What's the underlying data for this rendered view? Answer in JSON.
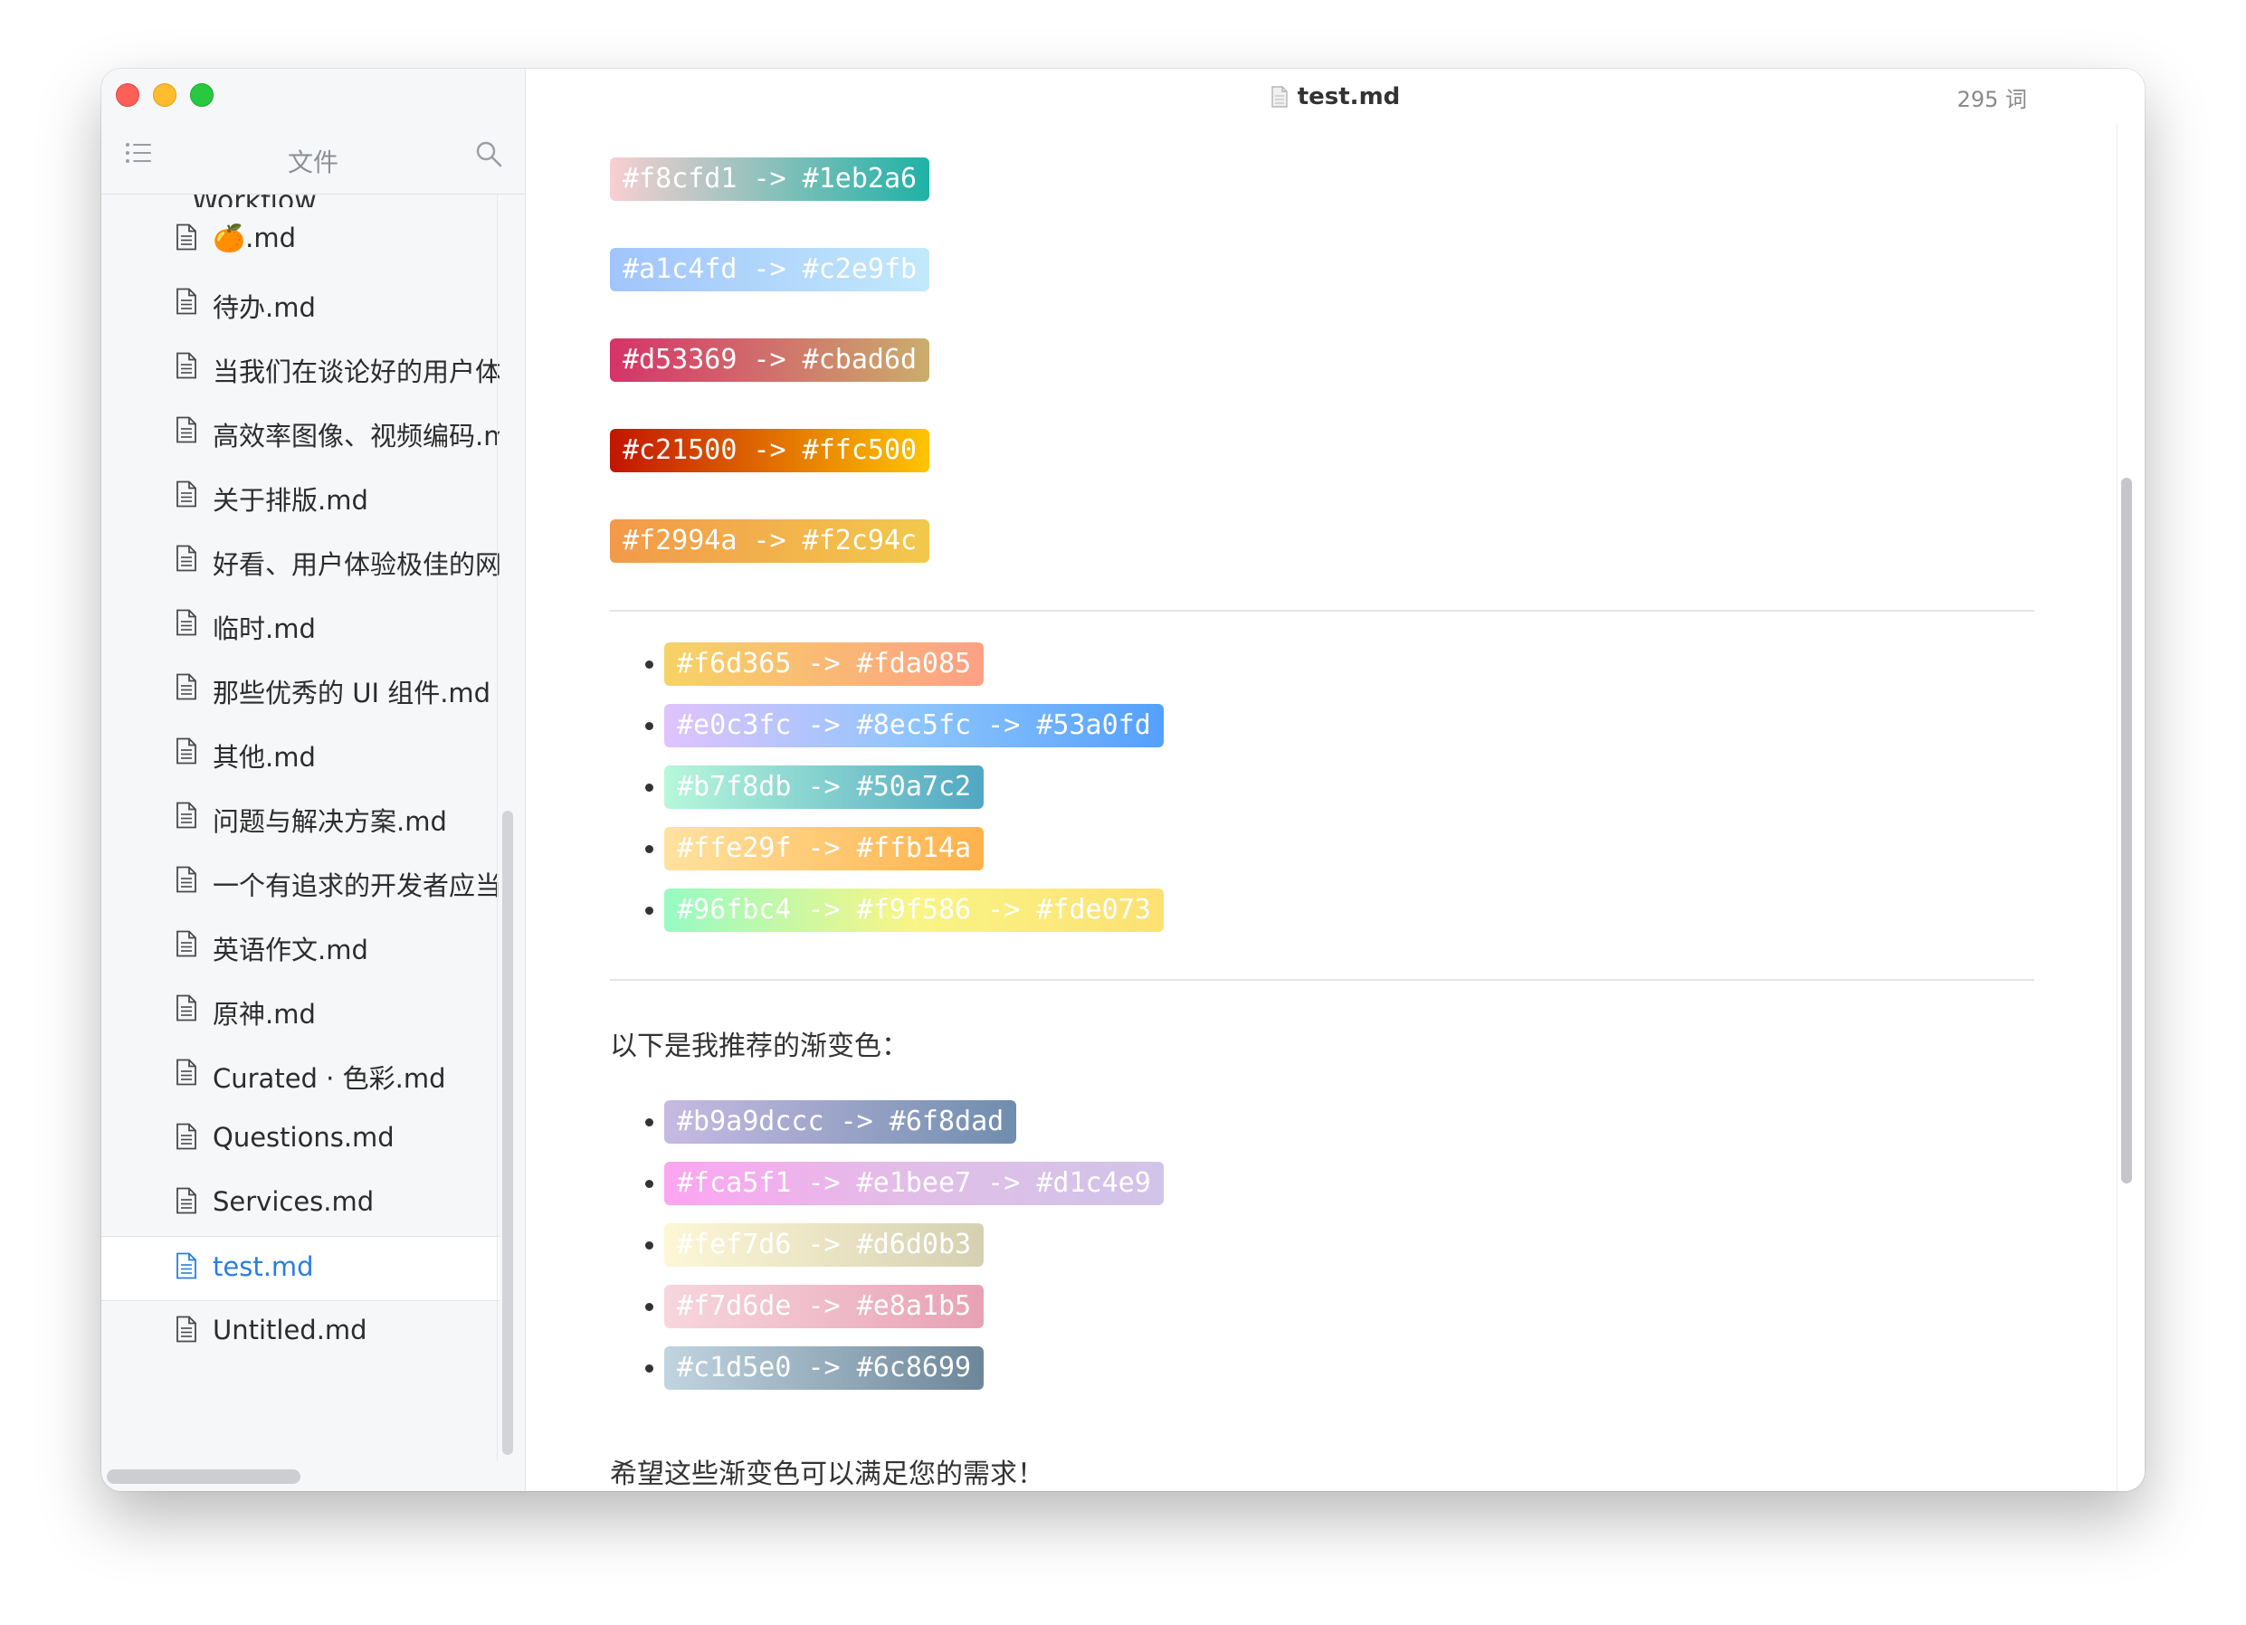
{
  "sidebar": {
    "title": "文件",
    "folder": "Workflow",
    "files": [
      {
        "name": "🍊.md",
        "active": false
      },
      {
        "name": "待办.md",
        "active": false
      },
      {
        "name": "当我们在谈论好的用户体验",
        "active": false
      },
      {
        "name": "高效率图像、视频编码.md",
        "active": false
      },
      {
        "name": "关于排版.md",
        "active": false
      },
      {
        "name": "好看、用户体验极佳的网页",
        "active": false
      },
      {
        "name": "临时.md",
        "active": false
      },
      {
        "name": "那些优秀的 UI 组件.md",
        "active": false
      },
      {
        "name": "其他.md",
        "active": false
      },
      {
        "name": "问题与解决方案.md",
        "active": false
      },
      {
        "name": "一个有追求的开发者应当",
        "active": false
      },
      {
        "name": "英语作文.md",
        "active": false
      },
      {
        "name": "原神.md",
        "active": false
      },
      {
        "name": "Curated · 色彩.md",
        "active": false
      },
      {
        "name": "Questions.md",
        "active": false
      },
      {
        "name": "Services.md",
        "active": false
      },
      {
        "name": "test.md",
        "active": true
      },
      {
        "name": "Untitled.md",
        "active": false
      }
    ]
  },
  "editor": {
    "title": "test.md",
    "wordcount": "295 词",
    "top_chips": [
      {
        "label": "#f8cfd1 -> #1eb2a6",
        "colors": [
          "#f8cfd1",
          "#1eb2a6"
        ]
      },
      {
        "label": "#a1c4fd -> #c2e9fb",
        "colors": [
          "#a1c4fd",
          "#c2e9fb"
        ]
      },
      {
        "label": "#d53369 -> #cbad6d",
        "colors": [
          "#d53369",
          "#cbad6d"
        ]
      },
      {
        "label": "#c21500 -> #ffc500",
        "colors": [
          "#c21500",
          "#ffc500"
        ]
      },
      {
        "label": "#f2994a -> #f2c94c",
        "colors": [
          "#f2994a",
          "#f2c94c"
        ]
      }
    ],
    "list1": [
      {
        "label": "#f6d365 -> #fda085",
        "colors": [
          "#f6d365",
          "#fda085"
        ]
      },
      {
        "label": "#e0c3fc -> #8ec5fc -> #53a0fd",
        "colors": [
          "#e0c3fc",
          "#8ec5fc",
          "#53a0fd"
        ]
      },
      {
        "label": "#b7f8db -> #50a7c2",
        "colors": [
          "#b7f8db",
          "#50a7c2"
        ]
      },
      {
        "label": "#ffe29f -> #ffb14a",
        "colors": [
          "#ffe29f",
          "#ffb14a"
        ]
      },
      {
        "label": "#96fbc4 -> #f9f586 -> #fde073",
        "colors": [
          "#96fbc4",
          "#f9f586",
          "#fde073"
        ]
      }
    ],
    "recommend_text": "以下是我推荐的渐变色：",
    "list2": [
      {
        "label": "#b9a9dccc -> #6f8dad",
        "colors": [
          "#b9a9dccc",
          "#6f8dad"
        ]
      },
      {
        "label": "#fca5f1 -> #e1bee7 -> #d1c4e9",
        "colors": [
          "#fca5f1",
          "#e1bee7",
          "#d1c4e9"
        ]
      },
      {
        "label": "#fef7d6 -> #d6d0b3",
        "colors": [
          "#fef7d6",
          "#d6d0b3"
        ]
      },
      {
        "label": "#f7d6de -> #e8a1b5",
        "colors": [
          "#f7d6de",
          "#e8a1b5"
        ]
      },
      {
        "label": "#c1d5e0 -> #6c8699",
        "colors": [
          "#c1d5e0",
          "#6c8699"
        ]
      }
    ],
    "closing_text": "希望这些渐变色可以满足您的需求！"
  }
}
